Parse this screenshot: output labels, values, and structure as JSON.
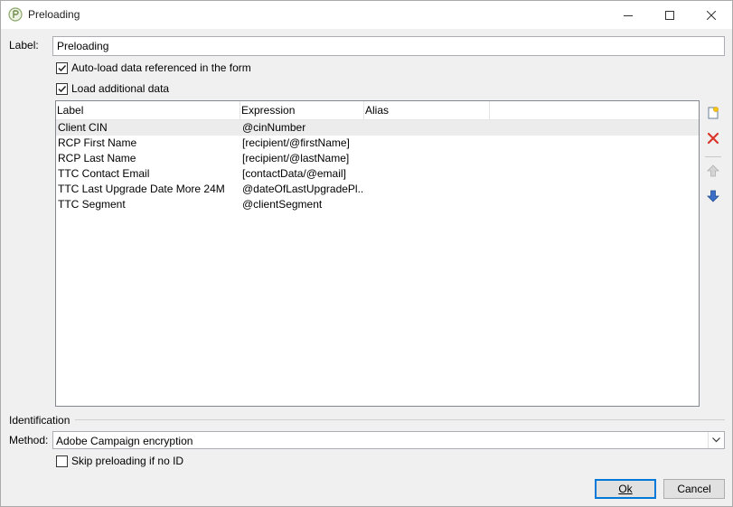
{
  "window": {
    "title": "Preloading"
  },
  "form": {
    "label_caption": "Label:",
    "label_value": "Preloading",
    "auto_load": {
      "label": "Auto-load data referenced in the form",
      "checked": true
    },
    "load_additional": {
      "label": "Load additional data",
      "checked": true
    }
  },
  "grid": {
    "columns": [
      "Label",
      "Expression",
      "Alias"
    ],
    "rows": [
      {
        "label": "Client CIN",
        "expression": "@cinNumber",
        "alias": ""
      },
      {
        "label": "RCP First Name",
        "expression": "[recipient/@firstName]",
        "alias": ""
      },
      {
        "label": "RCP Last Name",
        "expression": "[recipient/@lastName]",
        "alias": ""
      },
      {
        "label": "TTC Contact Email",
        "expression": "[contactData/@email]",
        "alias": ""
      },
      {
        "label": "TTC Last Upgrade Date More 24M",
        "expression": "@dateOfLastUpgradePl...",
        "alias": ""
      },
      {
        "label": "TTC Segment",
        "expression": "@clientSegment",
        "alias": ""
      }
    ]
  },
  "sidebar": {
    "add_icon": "add-item-icon",
    "delete_icon": "delete-icon",
    "up_icon": "arrow-up-icon",
    "down_icon": "arrow-down-icon"
  },
  "identification": {
    "group_label": "Identification",
    "method_caption": "Method:",
    "method_value": "Adobe Campaign encryption",
    "skip": {
      "label": "Skip preloading if no ID",
      "checked": false
    }
  },
  "buttons": {
    "ok": "Ok",
    "cancel": "Cancel"
  },
  "colors": {
    "default_button_border": "#0078d7",
    "delete_red": "#d9362b",
    "arrow_blue": "#3b6fc7"
  }
}
